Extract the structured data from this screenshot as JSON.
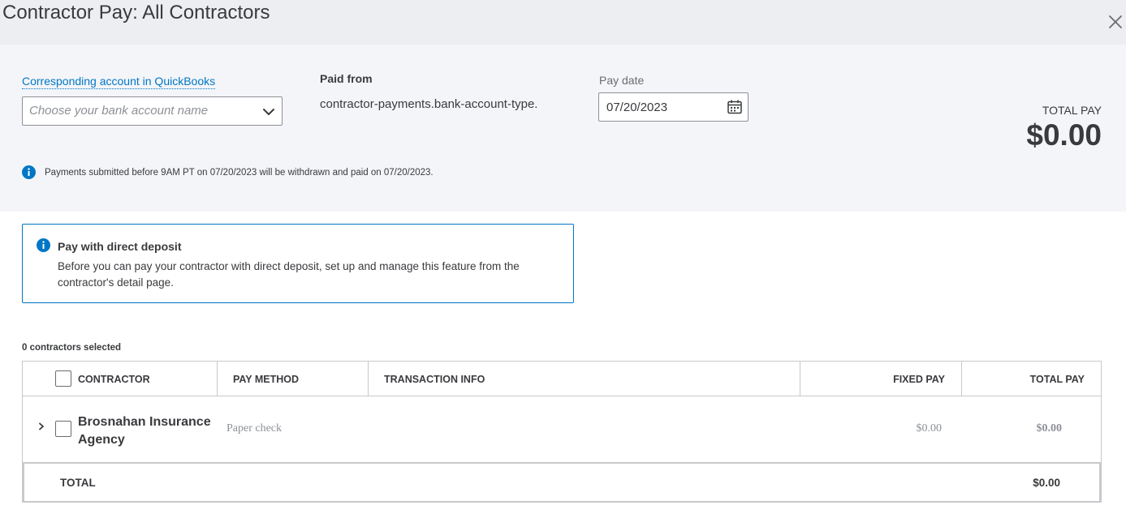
{
  "dialog": {
    "title": "Contractor Pay: All Contractors",
    "close_icon": "close-icon"
  },
  "account": {
    "link_label": "Corresponding account in QuickBooks",
    "placeholder": "Choose your bank account name",
    "value": ""
  },
  "paid_from": {
    "label": "Paid from",
    "value": "contractor-payments.bank-account-type."
  },
  "pay_date": {
    "label": "Pay date",
    "value": "07/20/2023"
  },
  "total_pay": {
    "label": "TOTAL PAY",
    "value": "$0.00"
  },
  "info_notice": "Payments submitted before 9AM PT on 07/20/2023 will be withdrawn and paid on 07/20/2023.",
  "direct_deposit": {
    "title": "Pay with direct deposit",
    "text": "Before you can pay your contractor with direct deposit, set up and manage this feature from the contractor's detail page."
  },
  "selection": {
    "count_text": "0 contractors selected"
  },
  "table": {
    "columns": {
      "contractor": "CONTRACTOR",
      "pay_method": "PAY METHOD",
      "transaction_info": "TRANSACTION INFO",
      "fixed_pay": "FIXED PAY",
      "total_pay": "TOTAL PAY"
    },
    "rows": [
      {
        "contractor": "Brosnahan Insurance Agency",
        "pay_method": "Paper check",
        "transaction_info": "",
        "fixed_pay": "$0.00",
        "total_pay": "$0.00"
      }
    ],
    "total": {
      "label": "TOTAL",
      "value": "$0.00"
    }
  },
  "colors": {
    "link": "#0077c5",
    "header_bg": "#eceef1",
    "section_bg": "#f4f5f8",
    "text": "#393a3d",
    "muted": "#8d9096",
    "border": "#c8c9cc"
  }
}
